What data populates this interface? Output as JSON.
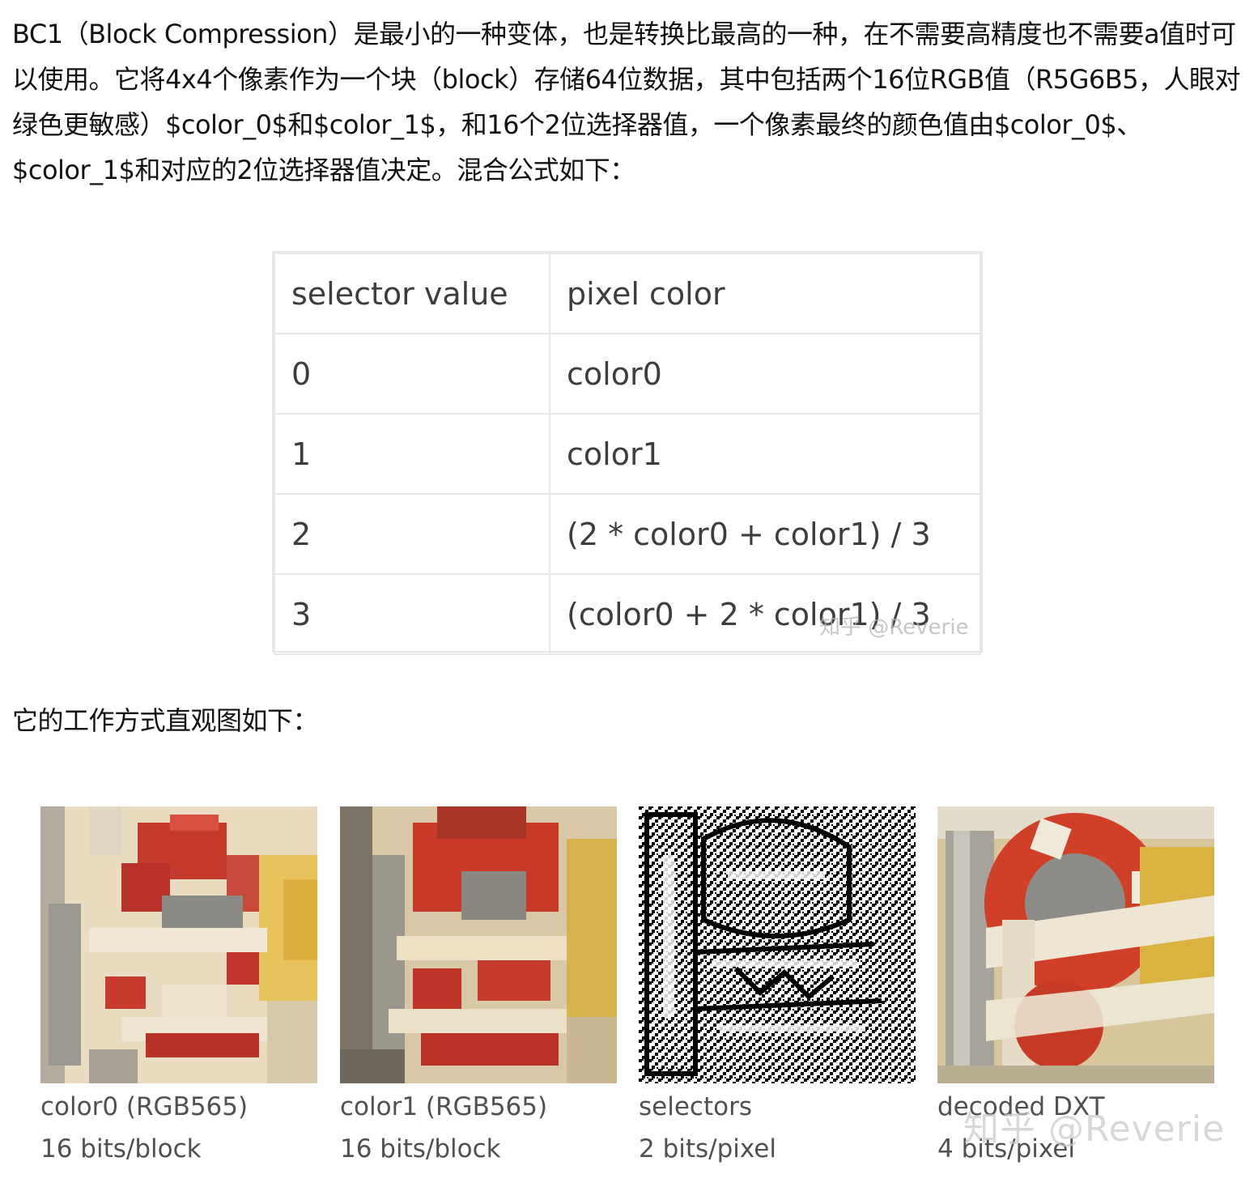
{
  "intro_paragraph": "BC1（Block Compression）是最小的一种变体，也是转换比最高的一种，在不需要高精度也不需要a值时可以使用。它将4x4个像素作为一个块（block）存储64位数据，其中包括两个16位RGB值（R5G6B5，人眼对绿色更敏感）$color_0$和$color_1$，和16个2位选择器值，一个像素最终的颜色值由$color_0$、$color_1$和对应的2位选择器值决定。混合公式如下：",
  "table": {
    "headers": [
      "selector value",
      "pixel color"
    ],
    "rows": [
      [
        "0",
        "color0"
      ],
      [
        "1",
        "color1"
      ],
      [
        "2",
        "(2 * color0 + color1) / 3"
      ],
      [
        "3",
        "(color0 + 2 * color1) / 3"
      ]
    ]
  },
  "table_watermark": "知乎 @Reverie",
  "second_paragraph": "它的工作方式直观图如下：",
  "figures": [
    {
      "line1": "color0 (RGB565)",
      "line2": "16 bits/block"
    },
    {
      "line1": "color1 (RGB565)",
      "line2": "16 bits/block"
    },
    {
      "line1": "selectors",
      "line2": "2 bits/pixel"
    },
    {
      "line1": "decoded DXT",
      "line2": "4 bits/pixel"
    }
  ],
  "figure_watermark": "知乎 @Reverie"
}
